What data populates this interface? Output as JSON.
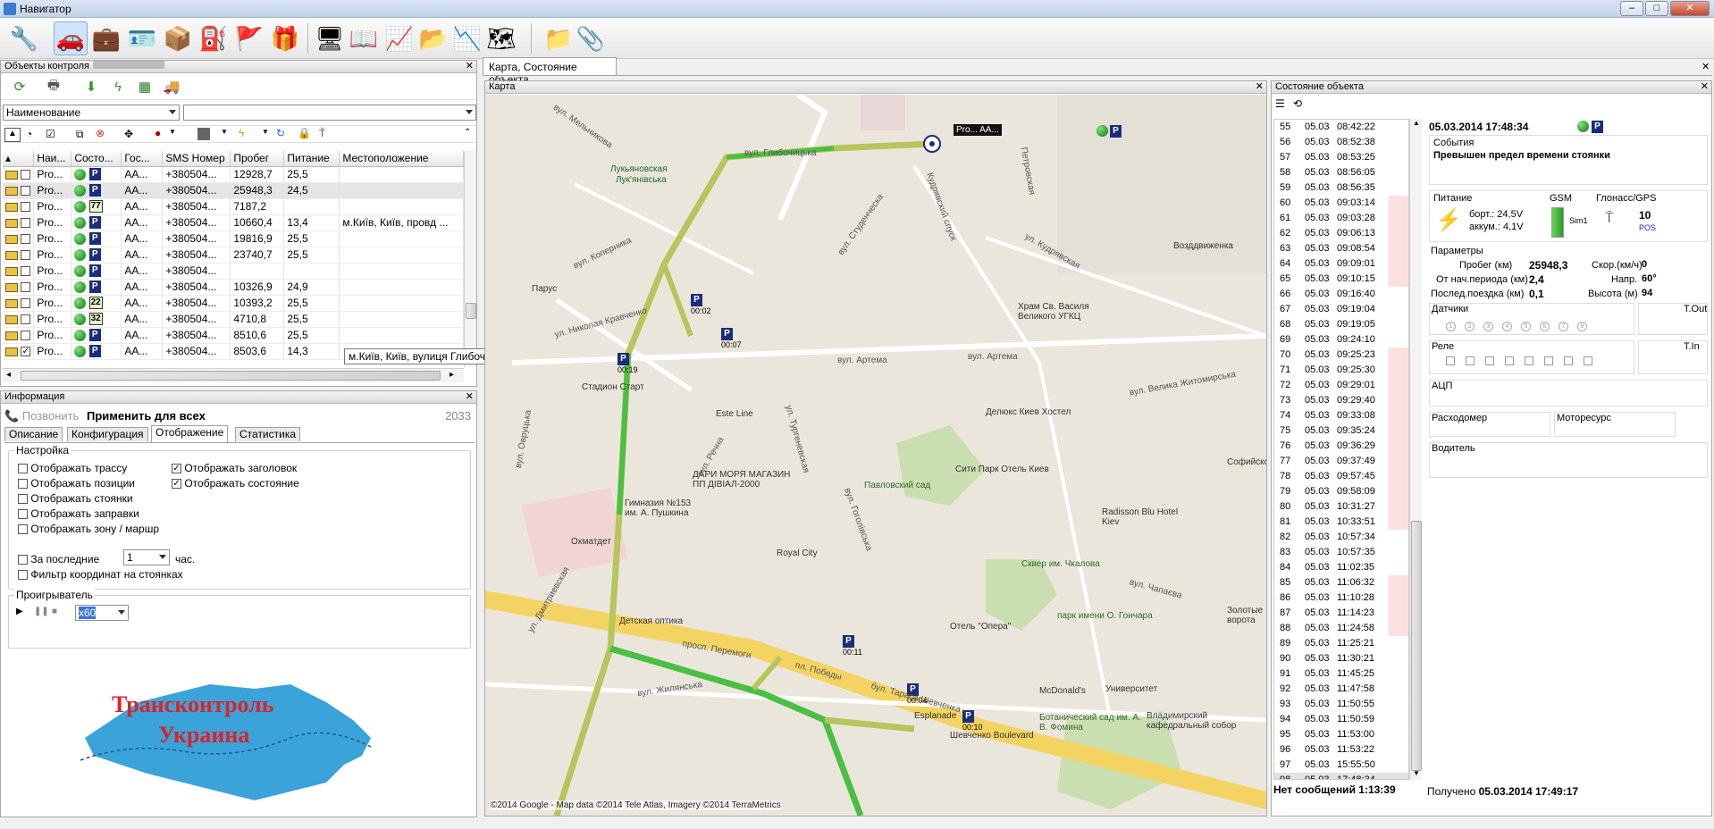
{
  "window": {
    "title": "Навигатор",
    "minimize": "–",
    "maximize": "□",
    "close": "✕"
  },
  "toolbar": {
    "icons": [
      "wrench-icon",
      "car-icon",
      "case-icon",
      "id-card-icon",
      "sled-icon",
      "pump-icon",
      "flag-icon",
      "box-icon",
      "terminal-icon",
      "book-icon",
      "chart-icon",
      "folder-icon",
      "graph-icon",
      "map-icon",
      "route-icon",
      "clip-icon"
    ]
  },
  "objects_panel": {
    "title": "Объекты контроля",
    "filter_select": "Наименование",
    "columns": [
      "Наи...",
      "Состо...",
      "Гос...",
      "SMS Номер",
      "Пробег",
      "Питание",
      "Местоположение"
    ],
    "rows": [
      {
        "name": "Pro...",
        "checked": false,
        "state": "P",
        "badge": "",
        "reg": "AA...",
        "sms": "+380504...",
        "mileage": "12928,7",
        "power": "25,5",
        "loc": ""
      },
      {
        "name": "Pro...",
        "checked": false,
        "state": "P",
        "badge": "",
        "reg": "AA...",
        "sms": "+380504...",
        "mileage": "25948,3",
        "power": "24,5",
        "loc": ""
      },
      {
        "name": "Pro...",
        "checked": false,
        "state": "",
        "badge": "77",
        "reg": "AA...",
        "sms": "+380504...",
        "mileage": "7187,2",
        "power": "",
        "loc": ""
      },
      {
        "name": "Pro...",
        "checked": false,
        "state": "P",
        "badge": "",
        "reg": "AA...",
        "sms": "+380504...",
        "mileage": "10660,4",
        "power": "13,4",
        "loc": "м.Київ, Київ, провд ..."
      },
      {
        "name": "Pro...",
        "checked": false,
        "state": "P",
        "badge": "",
        "reg": "AA...",
        "sms": "+380504...",
        "mileage": "19816,9",
        "power": "25,5",
        "loc": ""
      },
      {
        "name": "Pro...",
        "checked": false,
        "state": "P",
        "badge": "",
        "reg": "AA...",
        "sms": "+380504...",
        "mileage": "23740,7",
        "power": "25,5",
        "loc": ""
      },
      {
        "name": "Pro...",
        "checked": false,
        "state": "P",
        "badge": "",
        "reg": "AA...",
        "sms": "+380504...",
        "mileage": "",
        "power": "",
        "loc": ""
      },
      {
        "name": "Pro...",
        "checked": false,
        "state": "P",
        "badge": "",
        "reg": "AA...",
        "sms": "+380504...",
        "mileage": "10326,9",
        "power": "24,9",
        "loc": ""
      },
      {
        "name": "Pro...",
        "checked": false,
        "state": "",
        "badge": "22",
        "reg": "AA...",
        "sms": "+380504...",
        "mileage": "10393,2",
        "power": "25,5",
        "loc": ""
      },
      {
        "name": "Pro...",
        "checked": false,
        "state": "",
        "badge": "32",
        "reg": "AA...",
        "sms": "+380504...",
        "mileage": "4710,8",
        "power": "25,5",
        "loc": ""
      },
      {
        "name": "Pro...",
        "checked": false,
        "state": "P",
        "badge": "",
        "reg": "AA...",
        "sms": "+380504...",
        "mileage": "8510,6",
        "power": "25,5",
        "loc": ""
      },
      {
        "name": "Pro...",
        "checked": true,
        "state": "P",
        "badge": "",
        "reg": "AA...",
        "sms": "+380504...",
        "mileage": "8503,6",
        "power": "14,3",
        "loc": ""
      }
    ],
    "tooltip": "м.Київ, Київ, вулиця Глибочицька, 71"
  },
  "info_panel": {
    "title": "Информация",
    "call": "Позвонить",
    "apply_all": "Применить для всех",
    "id": "2033",
    "tabs": [
      "Описание",
      "Конфигурация",
      "Отображение",
      "Статистика"
    ],
    "settings_label": "Настройка",
    "options_left": [
      "Отображать трассу",
      "Отображать позиции",
      "Отображать стоянки",
      "Отображать заправки",
      "Отображать зону / маршр"
    ],
    "options_right": [
      "Отображать заголовок",
      "Отображать состояние"
    ],
    "last_label": "За последние",
    "last_value": "1",
    "hours": "час.",
    "filter_label": "Фильтр координат на стоянках",
    "player_label": "Проигрыватель",
    "speed": "x60",
    "logo_line1": "Трансконтроль",
    "logo_line2": "Украина"
  },
  "doc_tab": "Карта, Состояние объекта",
  "map": {
    "title": "Карта",
    "copyright": "©2014 Google - Map data ©2014 Tele Atlas, Imagery ©2014 TerraMetrics",
    "marker_label": "Pro...    AA...",
    "labels": [
      "Лукьяновская",
      "Лук'янівська",
      "Парус",
      "Стадион Старт",
      "Гимназия №153 им. А. Пушкина",
      "Охматдет",
      "Детская оптика",
      "Royal City",
      "Павловский сад",
      "Сквер им. Чкалова",
      "парк имени О. Гончара",
      "Университет",
      "Ботанический сад им. А. В. Фомина",
      "Делюкс Киев Хостел",
      "Сити Парк Отель Киев",
      "Radisson Blu Hotel Kiev",
      "Возддвиженка",
      "Храм Св. Василя Великого УГКЦ",
      "Отель \"Опера\"",
      "Esplanade",
      "Шевченко Boulevard",
      "ДАРИ МОРЯ МАГАЗИН ПП ДІВІАЛ-2000",
      "Este Line",
      "McDonald's",
      "Владимирский кафедральный собор",
      "Золотые ворота",
      "Софийско"
    ],
    "roads": [
      "вул. Мельникова",
      "вул. Глибочицька",
      "вул. Артема",
      "вул. Артема",
      "просп. Перемоги",
      "вул. Жилянська",
      "пл. Победы",
      "бул. Тараса Шевченка",
      "вул. Велика Житомирська",
      "вул. Чапаєва",
      "ул. Дмитриевская",
      "вул. Гоголівська",
      "вул. Овруцька",
      "вул. Студенческа",
      "ул. Тургеневская",
      "вул. Речна",
      "вул. Коперника",
      "ул. Николая Кравченко",
      "Кудрявский спуск",
      "Петровская",
      "ул. Кудрявская"
    ],
    "parking": [
      "00:19",
      "00:02",
      "00:07",
      "00:11",
      "00:04",
      "00:10"
    ]
  },
  "state_panel": {
    "title": "Состояние объекта",
    "messages": [
      [
        "55",
        "05.03",
        "08:42:22"
      ],
      [
        "56",
        "05.03",
        "08:52:38"
      ],
      [
        "57",
        "05.03",
        "08:53:25"
      ],
      [
        "58",
        "05.03",
        "08:56:05"
      ],
      [
        "59",
        "05.03",
        "08:56:35"
      ],
      [
        "60",
        "05.03",
        "09:03:14"
      ],
      [
        "61",
        "05.03",
        "09:03:28"
      ],
      [
        "62",
        "05.03",
        "09:06:13"
      ],
      [
        "63",
        "05.03",
        "09:08:54"
      ],
      [
        "64",
        "05.03",
        "09:09:01"
      ],
      [
        "65",
        "05.03",
        "09:10:15"
      ],
      [
        "66",
        "05.03",
        "09:16:40"
      ],
      [
        "67",
        "05.03",
        "09:19:04"
      ],
      [
        "68",
        "05.03",
        "09:19:05"
      ],
      [
        "69",
        "05.03",
        "09:24:10"
      ],
      [
        "70",
        "05.03",
        "09:25:23"
      ],
      [
        "71",
        "05.03",
        "09:25:30"
      ],
      [
        "72",
        "05.03",
        "09:29:01"
      ],
      [
        "73",
        "05.03",
        "09:29:40"
      ],
      [
        "74",
        "05.03",
        "09:33:08"
      ],
      [
        "75",
        "05.03",
        "09:35:24"
      ],
      [
        "76",
        "05.03",
        "09:36:29"
      ],
      [
        "77",
        "05.03",
        "09:37:49"
      ],
      [
        "78",
        "05.03",
        "09:57:45"
      ],
      [
        "79",
        "05.03",
        "09:58:09"
      ],
      [
        "80",
        "05.03",
        "10:31:27"
      ],
      [
        "81",
        "05.03",
        "10:33:51"
      ],
      [
        "82",
        "05.03",
        "10:57:34"
      ],
      [
        "83",
        "05.03",
        "10:57:35"
      ],
      [
        "84",
        "05.03",
        "11:02:35"
      ],
      [
        "85",
        "05.03",
        "11:06:32"
      ],
      [
        "86",
        "05.03",
        "11:10:28"
      ],
      [
        "87",
        "05.03",
        "11:14:23"
      ],
      [
        "88",
        "05.03",
        "11:24:58"
      ],
      [
        "89",
        "05.03",
        "11:25:21"
      ],
      [
        "90",
        "05.03",
        "11:30:21"
      ],
      [
        "91",
        "05.03",
        "11:45:25"
      ],
      [
        "92",
        "05.03",
        "11:47:58"
      ],
      [
        "93",
        "05.03",
        "11:50:55"
      ],
      [
        "94",
        "05.03",
        "11:50:59"
      ],
      [
        "95",
        "05.03",
        "11:53:00"
      ],
      [
        "96",
        "05.03",
        "11:53:22"
      ],
      [
        "97",
        "05.03",
        "15:55:50"
      ],
      [
        "98",
        "05.03",
        "17:48:34"
      ]
    ],
    "no_messages": "Нет сообщений 1:13:39",
    "datetime": "05.03.2014 17:48:34",
    "events_label": "События",
    "event": "Превышен предел времени стоянки",
    "power_label": "Питание",
    "board": "борт.: 24,5V",
    "battery": "аккум.: 4,1V",
    "gsm_label": "GSM",
    "sim": "Sim1",
    "glonass_label": "Глонасс/GPS",
    "sats": "10",
    "pos": "POS",
    "params_label": "Параметры",
    "mileage_label": "Пробег (км)",
    "mileage": "25948,3",
    "speed_label": "Скор.(км/ч)",
    "speed": "0",
    "period_label": "От нач.периода (км)",
    "period": "2,4",
    "dir_label": "Напр.",
    "dir": "60°",
    "lasttrip_label": "Послед.поездка (км)",
    "lasttrip": "0,1",
    "alt_label": "Высота (м)",
    "alt": "94",
    "sensors_label": "Датчики",
    "tout": "T.Out",
    "relay_label": "Реле",
    "tin": "T.In",
    "adc_label": "АЦП",
    "flow_label": "Расходомер",
    "motor_label": "Моторесурс",
    "driver_label": "Водитель",
    "received_label": "Получено",
    "received": "05.03.2014 17:49:17"
  }
}
